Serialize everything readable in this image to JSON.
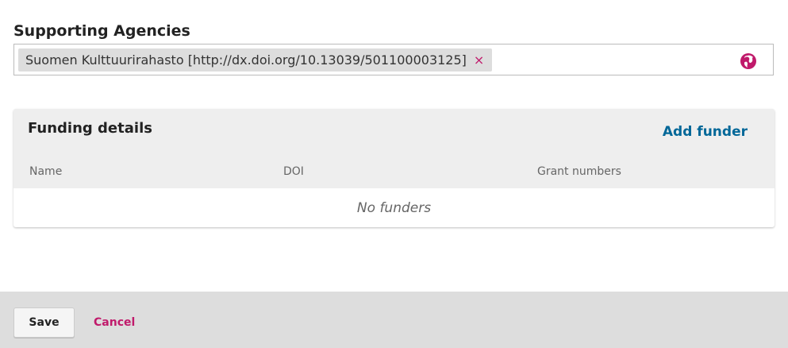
{
  "supporting_agencies": {
    "label": "Supporting Agencies",
    "tags": [
      {
        "text": "Suomen Kulttuurirahasto [http://dx.doi.org/10.13039/501100003125]",
        "remove": "×"
      }
    ],
    "lookup_icon": "globe-icon"
  },
  "funding_details": {
    "title": "Funding details",
    "add_funder": "Add funder",
    "columns": [
      "Name",
      "DOI",
      "Grant numbers"
    ],
    "empty_text": "No funders"
  },
  "footer": {
    "save_label": "Save",
    "cancel_label": "Cancel"
  },
  "colors": {
    "accent": "#006798",
    "brand": "#c01a6b",
    "panel_bg": "#eeeeee",
    "footer_bg": "#dddddd"
  }
}
